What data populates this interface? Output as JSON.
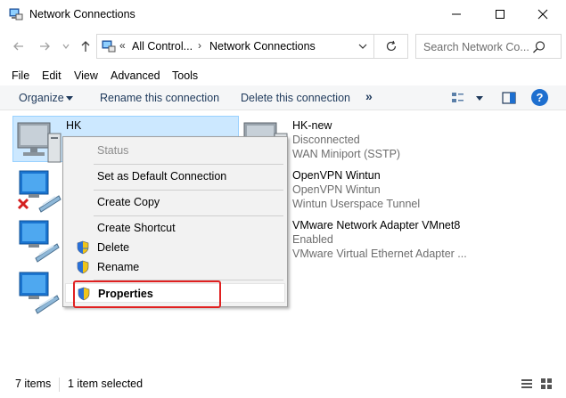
{
  "window": {
    "title": "Network Connections",
    "controls": {
      "minimize": "minimize-icon",
      "maximize": "maximize-icon",
      "close": "close-icon"
    }
  },
  "address": {
    "crumbs": [
      "All Control...",
      "Network Connections"
    ],
    "overflow": "«"
  },
  "search": {
    "placeholder": "Search Network Co..."
  },
  "menu": [
    "File",
    "Edit",
    "View",
    "Advanced",
    "Tools"
  ],
  "commands": {
    "organize": "Organize",
    "rename": "Rename this connection",
    "delete": "Delete this connection",
    "more": "»",
    "help": "?"
  },
  "connections": [
    {
      "name": "HK",
      "status": "",
      "device": "",
      "icon": "computer-network-icon",
      "selected": true
    },
    {
      "name": "",
      "status": "",
      "device": "",
      "icon": "network-adapter-disconnected-icon"
    },
    {
      "name": "",
      "status": "",
      "device": "",
      "icon": "network-adapter-icon"
    },
    {
      "name": "",
      "status": "",
      "device": "",
      "icon": "network-adapter-icon"
    },
    {
      "name": "HK-new",
      "status": "Disconnected",
      "device": "WAN Miniport (SSTP)",
      "icon": "computer-network-icon"
    },
    {
      "name": "OpenVPN Wintun",
      "status": "OpenVPN Wintun",
      "device": "Wintun Userspace Tunnel",
      "icon": "network-adapter-icon"
    },
    {
      "name": "VMware Network Adapter VMnet8",
      "status": "Enabled",
      "device": "VMware Virtual Ethernet Adapter ...",
      "icon": "network-adapter-icon"
    }
  ],
  "context_menu": {
    "items": [
      {
        "label": "Status",
        "disabled": true
      },
      {
        "label": "Set as Default Connection"
      },
      {
        "label": "Create Copy"
      },
      {
        "label": "Create Shortcut"
      },
      {
        "label": "Delete",
        "shield": true
      },
      {
        "label": "Rename",
        "shield": true
      },
      {
        "label": "Properties",
        "shield": true,
        "bold": true
      }
    ]
  },
  "status_bar": {
    "item_count": "7 items",
    "selection": "1 item selected"
  },
  "colors": {
    "accent": "#1e6fcf",
    "selection": "#cce8ff",
    "highlight_box": "#e02020"
  }
}
